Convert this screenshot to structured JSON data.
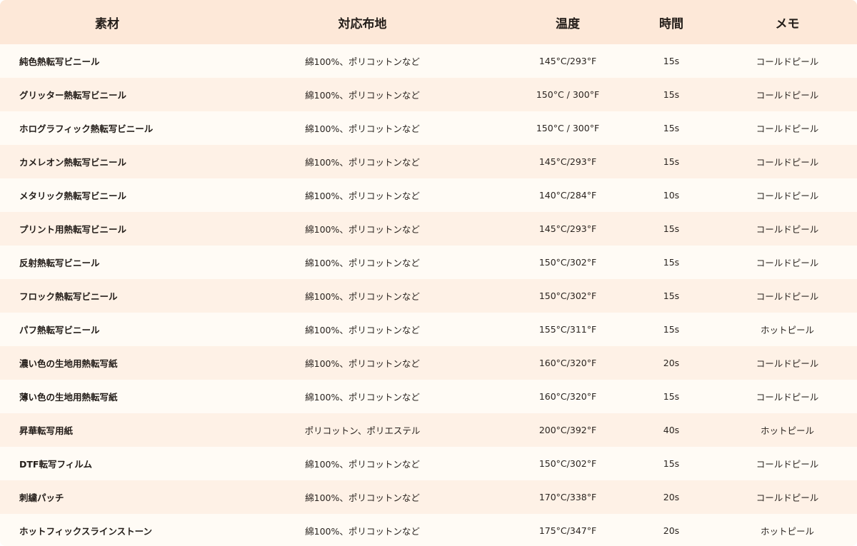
{
  "headers": {
    "material": "素材",
    "fabric": "対応布地",
    "temperature": "温度",
    "time": "時間",
    "memo": "メモ"
  },
  "rows": [
    {
      "material": "純色熱転写ビニール",
      "fabric": "綿100%、ポリコットンなど",
      "temperature": "145°C/293°F",
      "time": "15s",
      "memo": "コールドピール"
    },
    {
      "material": "グリッター熱転写ビニール",
      "fabric": "綿100%、ポリコットンなど",
      "temperature": "150°C / 300°F",
      "time": "15s",
      "memo": "コールドピール"
    },
    {
      "material": "ホログラフィック熱転写ビニール",
      "fabric": "綿100%、ポリコットンなど",
      "temperature": "150°C / 300°F",
      "time": "15s",
      "memo": "コールドピール"
    },
    {
      "material": "カメレオン熱転写ビニール",
      "fabric": "綿100%、ポリコットンなど",
      "temperature": "145°C/293°F",
      "time": "15s",
      "memo": "コールドピール"
    },
    {
      "material": "メタリック熱転写ビニール",
      "fabric": "綿100%、ポリコットンなど",
      "temperature": "140°C/284°F",
      "time": "10s",
      "memo": "コールドピール"
    },
    {
      "material": "プリント用熱転写ビニール",
      "fabric": "綿100%、ポリコットンなど",
      "temperature": "145°C/293°F",
      "time": "15s",
      "memo": "コールドピール"
    },
    {
      "material": "反射熱転写ビニール",
      "fabric": "綿100%、ポリコットンなど",
      "temperature": "150°C/302°F",
      "time": "15s",
      "memo": "コールドピール"
    },
    {
      "material": "フロック熱転写ビニール",
      "fabric": "綿100%、ポリコットンなど",
      "temperature": "150°C/302°F",
      "time": "15s",
      "memo": "コールドピール"
    },
    {
      "material": "パフ熱転写ビニール",
      "fabric": "綿100%、ポリコットンなど",
      "temperature": "155°C/311°F",
      "time": "15s",
      "memo": "ホットピール"
    },
    {
      "material": "濃い色の生地用熱転写紙",
      "fabric": "綿100%、ポリコットンなど",
      "temperature": "160°C/320°F",
      "time": "20s",
      "memo": "コールドピール"
    },
    {
      "material": "薄い色の生地用熱転写紙",
      "fabric": "綿100%、ポリコットンなど",
      "temperature": "160°C/320°F",
      "time": "15s",
      "memo": "コールドピール"
    },
    {
      "material": "昇華転写用紙",
      "fabric": "ポリコットン、ポリエステル",
      "temperature": "200°C/392°F",
      "time": "40s",
      "memo": "ホットピール"
    },
    {
      "material": "DTF転写フィルム",
      "fabric": "綿100%、ポリコットンなど",
      "temperature": "150°C/302°F",
      "time": "15s",
      "memo": "コールドピール"
    },
    {
      "material": "刺繍パッチ",
      "fabric": "綿100%、ポリコットンなど",
      "temperature": "170°C/338°F",
      "time": "20s",
      "memo": "コールドピール"
    },
    {
      "material": "ホットフィックスラインストーン",
      "fabric": "綿100%、ポリコットンなど",
      "temperature": "175°C/347°F",
      "time": "20s",
      "memo": "ホットピール"
    }
  ]
}
